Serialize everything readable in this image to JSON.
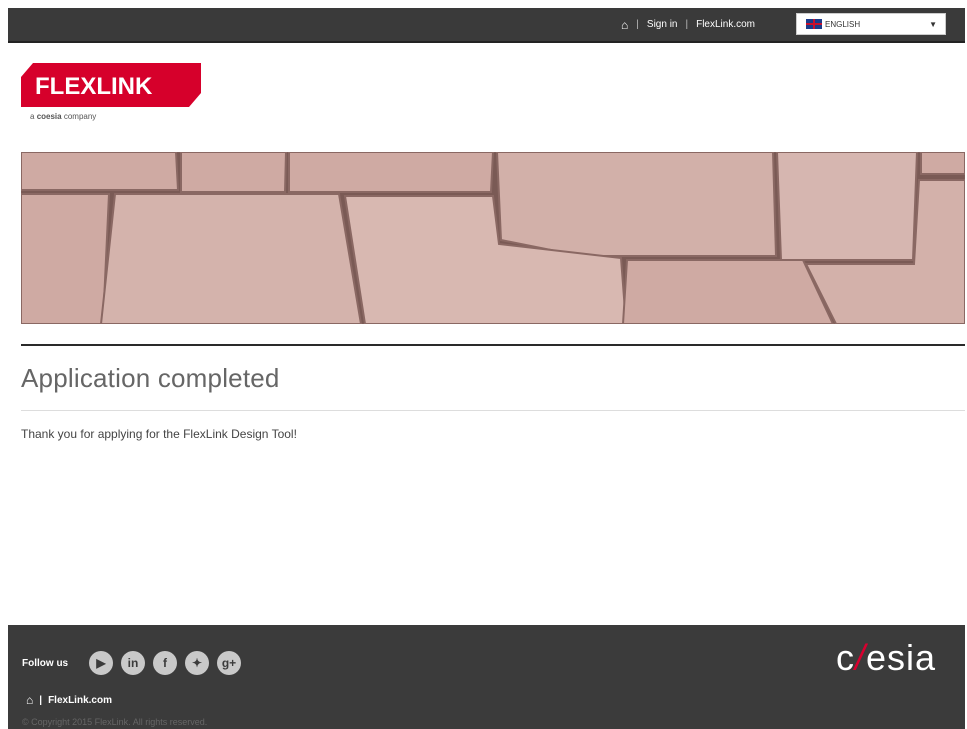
{
  "header": {
    "home_icon": "home-icon",
    "sign_in": "Sign in",
    "site_link": "FlexLink.com",
    "language": "ENGLISH",
    "separator": "|"
  },
  "logo": {
    "brand": "FLEXLINK",
    "sub_prefix": "a",
    "sub_brand": "coesia",
    "sub_suffix": "company",
    "brand_color": "#d6002b"
  },
  "main": {
    "title": "Application completed",
    "message": "Thank you for applying for the FlexLink Design Tool!"
  },
  "footer": {
    "follow_label": "Follow us",
    "social": [
      "youtube-icon",
      "linkedin-icon",
      "facebook-icon",
      "twitter-icon",
      "googleplus-icon"
    ],
    "site_link": "FlexLink.com",
    "copyright": "© Copyright 2015 FlexLink. All rights reserved.",
    "coesia_prefix": "c",
    "coesia_slash": "/",
    "coesia_suffix": "esia"
  }
}
